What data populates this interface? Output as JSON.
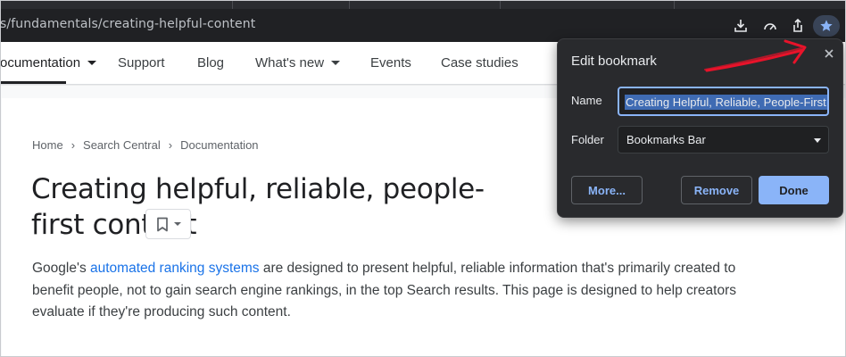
{
  "browser": {
    "url_text": "s/fundamentals/creating-helpful-content",
    "icons": [
      "download-icon",
      "performance-icon",
      "share-icon",
      "bookmark-star-icon"
    ]
  },
  "nav": {
    "items": [
      {
        "label": "ocumentation",
        "has_caret": true,
        "active": true
      },
      {
        "label": "Support"
      },
      {
        "label": "Blog"
      },
      {
        "label": "What's new",
        "has_caret": true
      },
      {
        "label": "Events"
      },
      {
        "label": "Case studies"
      }
    ]
  },
  "breadcrumb": [
    "Home",
    "Search Central",
    "Documentation"
  ],
  "page": {
    "title": "Creating helpful, reliable, people-first content",
    "intro_prefix": "Google's ",
    "intro_link": "automated ranking systems",
    "intro_suffix": " are designed to present helpful, reliable information that's primarily created to benefit people, not to gain search engine rankings, in the top Search results. This page is designed to help creators evaluate if they're producing such content."
  },
  "bookmark_dialog": {
    "title": "Edit bookmark",
    "name_label": "Name",
    "name_value": "Creating Helpful, Reliable, People-First",
    "folder_label": "Folder",
    "folder_value": "Bookmarks Bar",
    "more_label": "More...",
    "remove_label": "Remove",
    "done_label": "Done"
  },
  "colors": {
    "link": "#1a73e8",
    "dialog_bg": "#292a2d",
    "accent": "#8ab4f8",
    "annotation": "#e8132a"
  }
}
